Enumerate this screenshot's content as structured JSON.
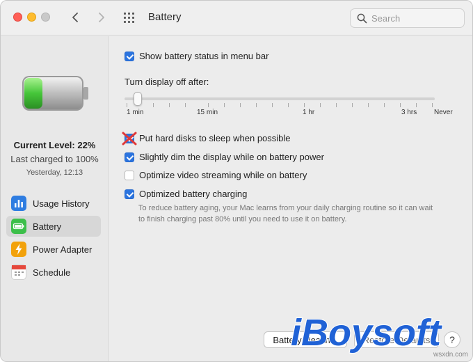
{
  "window": {
    "title": "Battery"
  },
  "search": {
    "placeholder": "Search"
  },
  "status": {
    "current_level": "Current Level: 22%",
    "last_charged": "Last charged to 100%",
    "last_charged_time": "Yesterday, 12:13",
    "battery_fill_fraction": 0.22
  },
  "sidebar": {
    "items": [
      {
        "label": "Usage History",
        "icon": "usage-history-icon",
        "active": false
      },
      {
        "label": "Battery",
        "icon": "battery-icon",
        "active": true
      },
      {
        "label": "Power Adapter",
        "icon": "power-adapter-icon",
        "active": false
      },
      {
        "label": "Schedule",
        "icon": "schedule-icon",
        "active": false
      }
    ]
  },
  "settings": {
    "show_status": {
      "label": "Show battery status in menu bar",
      "checked": true
    },
    "display_off_label": "Turn display off after:",
    "display_off_slider": {
      "value": "1 min",
      "ticks": [
        "1 min",
        "15 min",
        "1 hr",
        "3 hrs",
        "Never"
      ]
    },
    "hard_disks": {
      "label": "Put hard disks to sleep when possible",
      "checked": true
    },
    "dim_display": {
      "label": "Slightly dim the display while on battery power",
      "checked": true
    },
    "video_streaming": {
      "label": "Optimize video streaming while on battery",
      "checked": false
    },
    "optimized_charging": {
      "label": "Optimized battery charging",
      "checked": true,
      "note_line_1": "To reduce battery aging, your Mac learns from your daily charging routine so it can wait",
      "note_line_2": "to finish charging past 80% until you need to use it on battery."
    }
  },
  "buttons": {
    "battery_health": "Battery Health...",
    "restore_defaults": "Restore Defaults",
    "help": "?"
  },
  "watermark": {
    "logo_text": "iBoysoft",
    "site": "wsxdn.com"
  },
  "colors": {
    "accent": "#2b74df",
    "battery_green": "#46c63a",
    "annotation_red": "#e03a3a",
    "logo_blue": "#2062d6"
  }
}
